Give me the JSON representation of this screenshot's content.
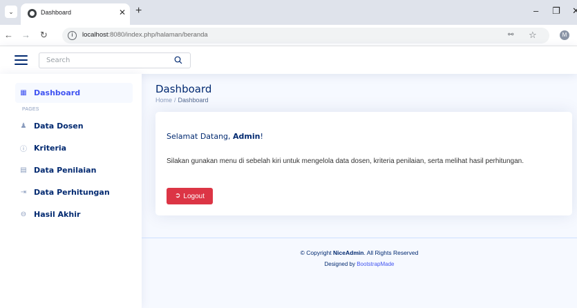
{
  "browser": {
    "tab_title": "Dashboard",
    "url_host": "localhost",
    "url_path": ":8080/index.php/halaman/beranda",
    "avatar_letter": "M"
  },
  "header": {
    "search_placeholder": "Search"
  },
  "sidebar": {
    "items": [
      {
        "label": "Dashboard",
        "icon": "grid-icon",
        "active": true
      },
      {
        "label": "Data Dosen",
        "icon": "person-icon"
      },
      {
        "label": "Kriteria",
        "icon": "question-circle-icon"
      },
      {
        "label": "Data Penilaian",
        "icon": "card-list-icon"
      },
      {
        "label": "Data Perhitungan",
        "icon": "box-arrow-in-icon"
      },
      {
        "label": "Hasil Akhir",
        "icon": "dash-circle-icon"
      }
    ],
    "heading_pages": "PAGES"
  },
  "main": {
    "page_title": "Dashboard",
    "breadcrumb": [
      "Home",
      "Dashboard"
    ],
    "welcome_prefix": "Selamat Datang, ",
    "welcome_name": "Admin",
    "welcome_suffix": "!",
    "description": "Silakan gunakan menu di sebelah kiri untuk mengelola data dosen, kriteria penilaian, serta melihat hasil perhitungan.",
    "logout_label": "Logout"
  },
  "footer": {
    "copyright_prefix": "© Copyright ",
    "brand": "NiceAdmin",
    "copyright_suffix": ". All Rights Reserved",
    "designed_by": "Designed by ",
    "designer": "BootstrapMade"
  },
  "colors": {
    "accent": "#4154f1",
    "navy": "#012970",
    "danger": "#dc3545",
    "background": "#f6f9ff"
  }
}
